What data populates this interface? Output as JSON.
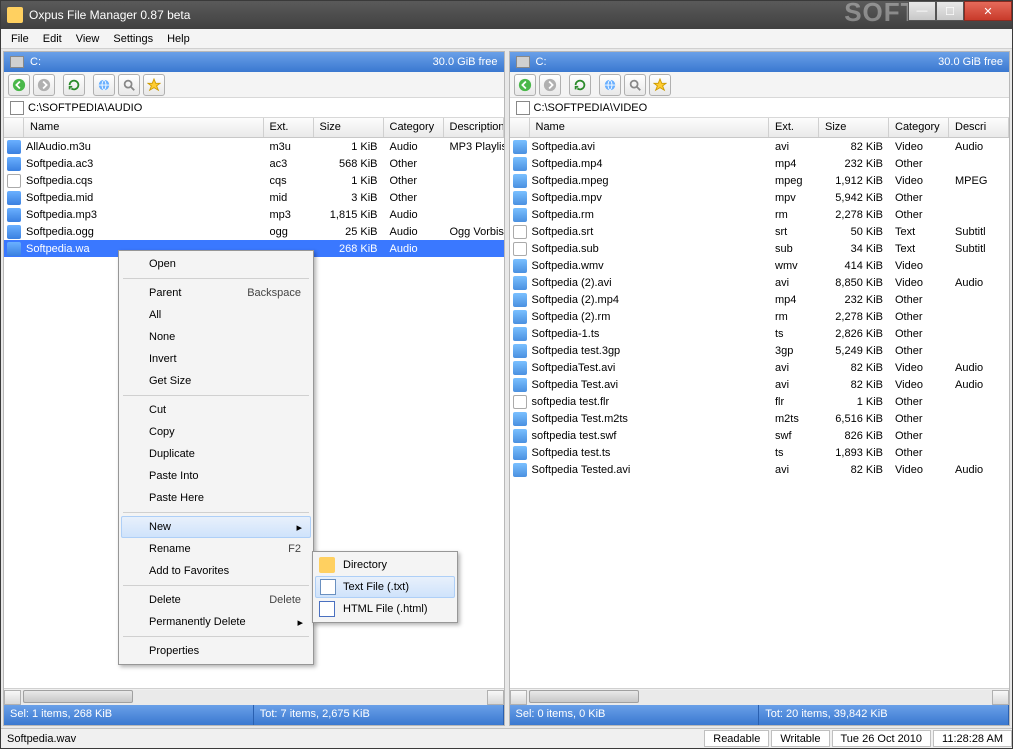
{
  "window": {
    "title": "Oxpus File Manager 0.87 beta"
  },
  "menus": [
    "File",
    "Edit",
    "View",
    "Settings",
    "Help"
  ],
  "drivebar": {
    "label": "C:",
    "free": "30.0 GiB free"
  },
  "left": {
    "path": "C:\\SOFTPEDIA\\AUDIO",
    "headers": [
      "Name",
      "Ext.",
      "Size",
      "Category",
      "Description"
    ],
    "files": [
      {
        "name": "AllAudio.m3u",
        "ext": "m3u",
        "size": "1 KiB",
        "cat": "Audio",
        "desc": "MP3 Playlis",
        "icon": "audio"
      },
      {
        "name": "Softpedia.ac3",
        "ext": "ac3",
        "size": "568 KiB",
        "cat": "Other",
        "desc": "",
        "icon": "audio"
      },
      {
        "name": "Softpedia.cqs",
        "ext": "cqs",
        "size": "1 KiB",
        "cat": "Other",
        "desc": "",
        "icon": "page"
      },
      {
        "name": "Softpedia.mid",
        "ext": "mid",
        "size": "3 KiB",
        "cat": "Other",
        "desc": "",
        "icon": "audio"
      },
      {
        "name": "Softpedia.mp3",
        "ext": "mp3",
        "size": "1,815 KiB",
        "cat": "Audio",
        "desc": "",
        "icon": "audio"
      },
      {
        "name": "Softpedia.ogg",
        "ext": "ogg",
        "size": "25 KiB",
        "cat": "Audio",
        "desc": "Ogg Vorbis",
        "icon": "audio"
      },
      {
        "name": "Softpedia.wa",
        "ext": "",
        "size": "268 KiB",
        "cat": "Audio",
        "desc": "",
        "icon": "audio",
        "sel": true
      }
    ],
    "status": {
      "sel": "Sel: 1 items, 268 KiB",
      "tot": "Tot: 7 items, 2,675 KiB"
    }
  },
  "right": {
    "path": "C:\\SOFTPEDIA\\VIDEO",
    "headers": [
      "Name",
      "Ext.",
      "Size",
      "Category",
      "Descri"
    ],
    "files": [
      {
        "name": "Softpedia.avi",
        "ext": "avi",
        "size": "82 KiB",
        "cat": "Video",
        "desc": "Audio",
        "icon": "video"
      },
      {
        "name": "Softpedia.mp4",
        "ext": "mp4",
        "size": "232 KiB",
        "cat": "Other",
        "desc": "",
        "icon": "video"
      },
      {
        "name": "Softpedia.mpeg",
        "ext": "mpeg",
        "size": "1,912 KiB",
        "cat": "Video",
        "desc": "MPEG",
        "icon": "video"
      },
      {
        "name": "Softpedia.mpv",
        "ext": "mpv",
        "size": "5,942 KiB",
        "cat": "Other",
        "desc": "",
        "icon": "video"
      },
      {
        "name": "Softpedia.rm",
        "ext": "rm",
        "size": "2,278 KiB",
        "cat": "Other",
        "desc": "",
        "icon": "video"
      },
      {
        "name": "Softpedia.srt",
        "ext": "srt",
        "size": "50 KiB",
        "cat": "Text",
        "desc": "Subtitl",
        "icon": "page"
      },
      {
        "name": "Softpedia.sub",
        "ext": "sub",
        "size": "34 KiB",
        "cat": "Text",
        "desc": "Subtitl",
        "icon": "page"
      },
      {
        "name": "Softpedia.wmv",
        "ext": "wmv",
        "size": "414 KiB",
        "cat": "Video",
        "desc": "",
        "icon": "video"
      },
      {
        "name": "Softpedia (2).avi",
        "ext": "avi",
        "size": "8,850 KiB",
        "cat": "Video",
        "desc": "Audio",
        "icon": "video"
      },
      {
        "name": "Softpedia (2).mp4",
        "ext": "mp4",
        "size": "232 KiB",
        "cat": "Other",
        "desc": "",
        "icon": "video"
      },
      {
        "name": "Softpedia (2).rm",
        "ext": "rm",
        "size": "2,278 KiB",
        "cat": "Other",
        "desc": "",
        "icon": "video"
      },
      {
        "name": "Softpedia-1.ts",
        "ext": "ts",
        "size": "2,826 KiB",
        "cat": "Other",
        "desc": "",
        "icon": "video"
      },
      {
        "name": "Softpedia test.3gp",
        "ext": "3gp",
        "size": "5,249 KiB",
        "cat": "Other",
        "desc": "",
        "icon": "video"
      },
      {
        "name": "SoftpediaTest.avi",
        "ext": "avi",
        "size": "82 KiB",
        "cat": "Video",
        "desc": "Audio",
        "icon": "video"
      },
      {
        "name": "Softpedia Test.avi",
        "ext": "avi",
        "size": "82 KiB",
        "cat": "Video",
        "desc": "Audio",
        "icon": "video"
      },
      {
        "name": "softpedia test.flr",
        "ext": "flr",
        "size": "1 KiB",
        "cat": "Other",
        "desc": "",
        "icon": "page"
      },
      {
        "name": "Softpedia Test.m2ts",
        "ext": "m2ts",
        "size": "6,516 KiB",
        "cat": "Other",
        "desc": "",
        "icon": "video"
      },
      {
        "name": "softpedia test.swf",
        "ext": "swf",
        "size": "826 KiB",
        "cat": "Other",
        "desc": "",
        "icon": "video"
      },
      {
        "name": "Softpedia test.ts",
        "ext": "ts",
        "size": "1,893 KiB",
        "cat": "Other",
        "desc": "",
        "icon": "video"
      },
      {
        "name": "Softpedia Tested.avi",
        "ext": "avi",
        "size": "82 KiB",
        "cat": "Video",
        "desc": "Audio",
        "icon": "video"
      }
    ],
    "status": {
      "sel": "Sel: 0 items, 0 KiB",
      "tot": "Tot: 20 items, 39,842 KiB"
    }
  },
  "context": {
    "items": [
      "Open",
      "-",
      "Parent",
      "All",
      "None",
      "Invert",
      "Get Size",
      "-",
      "Cut",
      "Copy",
      "Duplicate",
      "Paste Into",
      "Paste Here",
      "-",
      "New",
      "Rename",
      "Add to Favorites",
      "-",
      "Delete",
      "Permanently Delete",
      "-",
      "Properties"
    ],
    "shortcuts": {
      "Parent": "Backspace",
      "Rename": "F2",
      "Delete": "Delete"
    },
    "arrows": [
      "New",
      "Permanently Delete"
    ],
    "hover": "New"
  },
  "submenu": {
    "items": [
      "Directory",
      "Text File (.txt)",
      "HTML File (.html)"
    ],
    "hover": "Text File (.txt)",
    "icons": [
      "folder",
      "txt",
      "html"
    ]
  },
  "statusbar": {
    "filename": "Softpedia.wav",
    "readable": "Readable",
    "writable": "Writable",
    "date": "Tue 26 Oct 2010",
    "time": "11:28:28 AM"
  },
  "watermark": "SOFTPEDIA"
}
